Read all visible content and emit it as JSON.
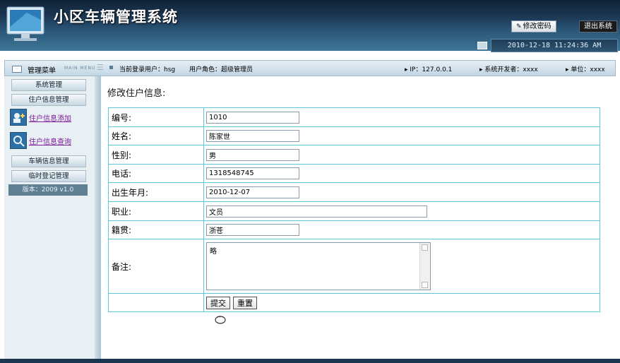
{
  "header": {
    "app_title": "小区车辆管理系统",
    "change_password_label": "修改密码",
    "change_password_icon": "key-icon",
    "logout_label": "退出系统",
    "datetime": "2010-12-18 11:24:36 AM"
  },
  "infobar": {
    "menu_title": "管理菜单",
    "menu_sub": "MAIN MENU",
    "current_user": "当前登录用户：hsg",
    "user_role": "用户角色：超级管理员",
    "ip": "▸ IP：127.0.0.1",
    "developer": "▸  系统开发者：xxxx",
    "unit": "▸  单位：xxxx"
  },
  "sidebar": {
    "groups": [
      {
        "label": "系统管理"
      },
      {
        "label": "住户信息管理"
      },
      {
        "label": "车辆信息管理"
      },
      {
        "label": "临时登记管理"
      }
    ],
    "sub_items": [
      {
        "label": "住户信息添加",
        "icon": "add-resident-icon"
      },
      {
        "label": "住户信息查询",
        "icon": "search-resident-icon"
      }
    ],
    "version": "版本：2009 v1.0"
  },
  "main": {
    "page_title": "修改住户信息:",
    "fields": {
      "id": {
        "label": "编号:",
        "value": "1010"
      },
      "name": {
        "label": "姓名:",
        "value": "陈家世"
      },
      "gender": {
        "label": "性别:",
        "value": "男"
      },
      "phone": {
        "label": "电话:",
        "value": "1318548745"
      },
      "birth": {
        "label": "出生年月:",
        "value": "2010-12-07"
      },
      "occupation": {
        "label": "职业:",
        "value": "文员"
      },
      "hometown": {
        "label": "籍贯:",
        "value": "浙苍"
      },
      "remark": {
        "label": "备注:",
        "value": "略"
      }
    },
    "submit_label": "提交",
    "reset_label": "重置"
  },
  "colors": {
    "header_dark": "#0f2134",
    "table_border": "#5fc7d8",
    "link_purple": "#7b1b9a"
  }
}
